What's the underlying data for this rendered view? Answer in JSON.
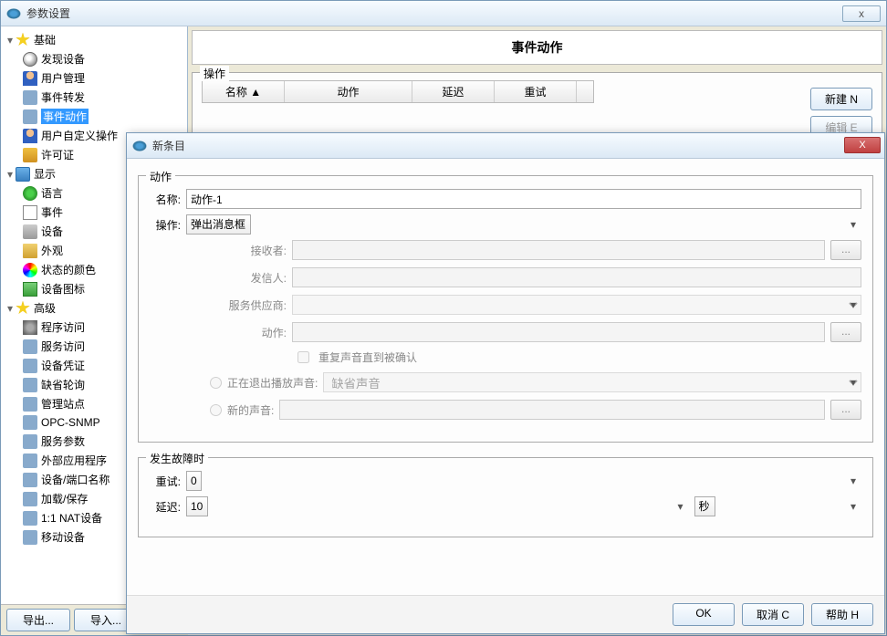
{
  "mainWindow": {
    "title": "参数设置",
    "sidebar": {
      "groups": [
        {
          "label": "基础",
          "items": [
            "发现设备",
            "用户管理",
            "事件转发",
            "事件动作",
            "用户自定义操作",
            "许可证"
          ]
        },
        {
          "label": "显示",
          "items": [
            "语言",
            "事件",
            "设备",
            "外观",
            "状态的颜色",
            "设备图标"
          ]
        },
        {
          "label": "高级",
          "items": [
            "程序访问",
            "服务访问",
            "设备凭证",
            "缺省轮询",
            "管理站点",
            "OPC-SNMP",
            "服务参数",
            "外部应用程序",
            "设备/端口名称",
            "加载/保存",
            "1:1 NAT设备",
            "移动设备"
          ]
        }
      ],
      "selected": "事件动作"
    },
    "panel": {
      "title": "事件动作",
      "operationLegend": "操作",
      "columns": [
        "名称 ▲",
        "动作",
        "延迟",
        "重试"
      ],
      "buttons": {
        "new": "新建 N",
        "edit": "编辑 E"
      }
    },
    "footer": {
      "export": "导出...",
      "import": "导入..."
    }
  },
  "dialog": {
    "title": "新条目",
    "actionGroup": {
      "legend": "动作",
      "nameLabel": "名称:",
      "nameValue": "动作-1",
      "opLabel": "操作:",
      "opValue": "弹出消息框",
      "fields": {
        "receiver": "接收者:",
        "sender": "发信人:",
        "provider": "服务供应商:",
        "action": "动作:"
      },
      "repeatSound": "重复声音直到被确认",
      "playingSound": "正在退出播放声音:",
      "defaultSound": "缺省声音",
      "newSound": "新的声音:",
      "dots": "..."
    },
    "failureGroup": {
      "legend": "发生故障时",
      "retryLabel": "重试:",
      "retryValue": "0",
      "delayLabel": "延迟:",
      "delayValue": "10",
      "delayUnit": "秒"
    },
    "buttons": {
      "ok": "OK",
      "cancel": "取消 C",
      "help": "帮助 H"
    }
  }
}
